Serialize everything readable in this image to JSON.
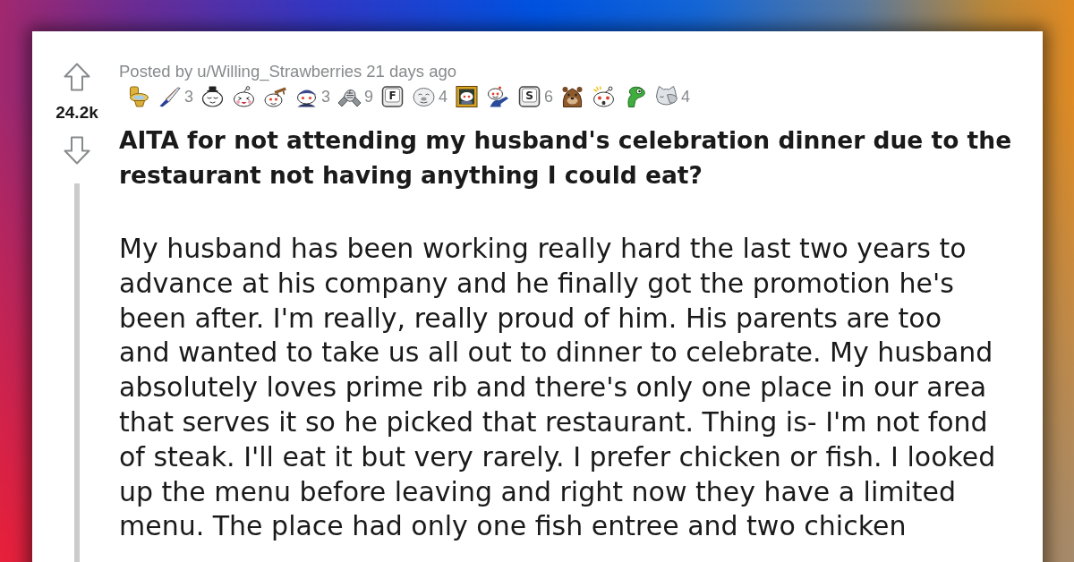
{
  "vote": {
    "score": "24.2k"
  },
  "post": {
    "byline": {
      "prefix": "Posted by",
      "author": "u/Willing_Strawberries",
      "age": "21 days ago"
    },
    "awards": [
      {
        "kind": "toilet"
      },
      {
        "kind": "knife",
        "count": "3"
      },
      {
        "kind": "sleepy"
      },
      {
        "kind": "laughing"
      },
      {
        "kind": "tableflip"
      },
      {
        "kind": "cap",
        "count": "3"
      },
      {
        "kind": "handshake",
        "count": "9"
      },
      {
        "kind": "key",
        "label": "F"
      },
      {
        "kind": "seal",
        "count": "4"
      },
      {
        "kind": "portrait"
      },
      {
        "kind": "pointing"
      },
      {
        "kind": "key",
        "label": "S",
        "count": "6"
      },
      {
        "kind": "bear"
      },
      {
        "kind": "surprised"
      },
      {
        "kind": "dino"
      },
      {
        "kind": "facepalm",
        "count": "4"
      }
    ],
    "title": "AITA for not attending my husband's celebration dinner due to the restaurant not having anything I could eat?",
    "body": "My husband has been working really hard the last two years to\nadvance at his company and he finally got the promotion he's\nbeen after. I'm really, really proud of him. His parents are too\nand wanted to take us all out to dinner to celebrate. My husband\nabsolutely loves prime rib and there's only one place in our area\nthat serves it so he picked that restaurant. Thing is- I'm not fond\nof steak. I'll eat it but very rarely. I prefer chicken or fish. I looked\nup the menu before leaving and right now they have a limited\nmenu. The place had only one fish entree and two chicken"
  }
}
